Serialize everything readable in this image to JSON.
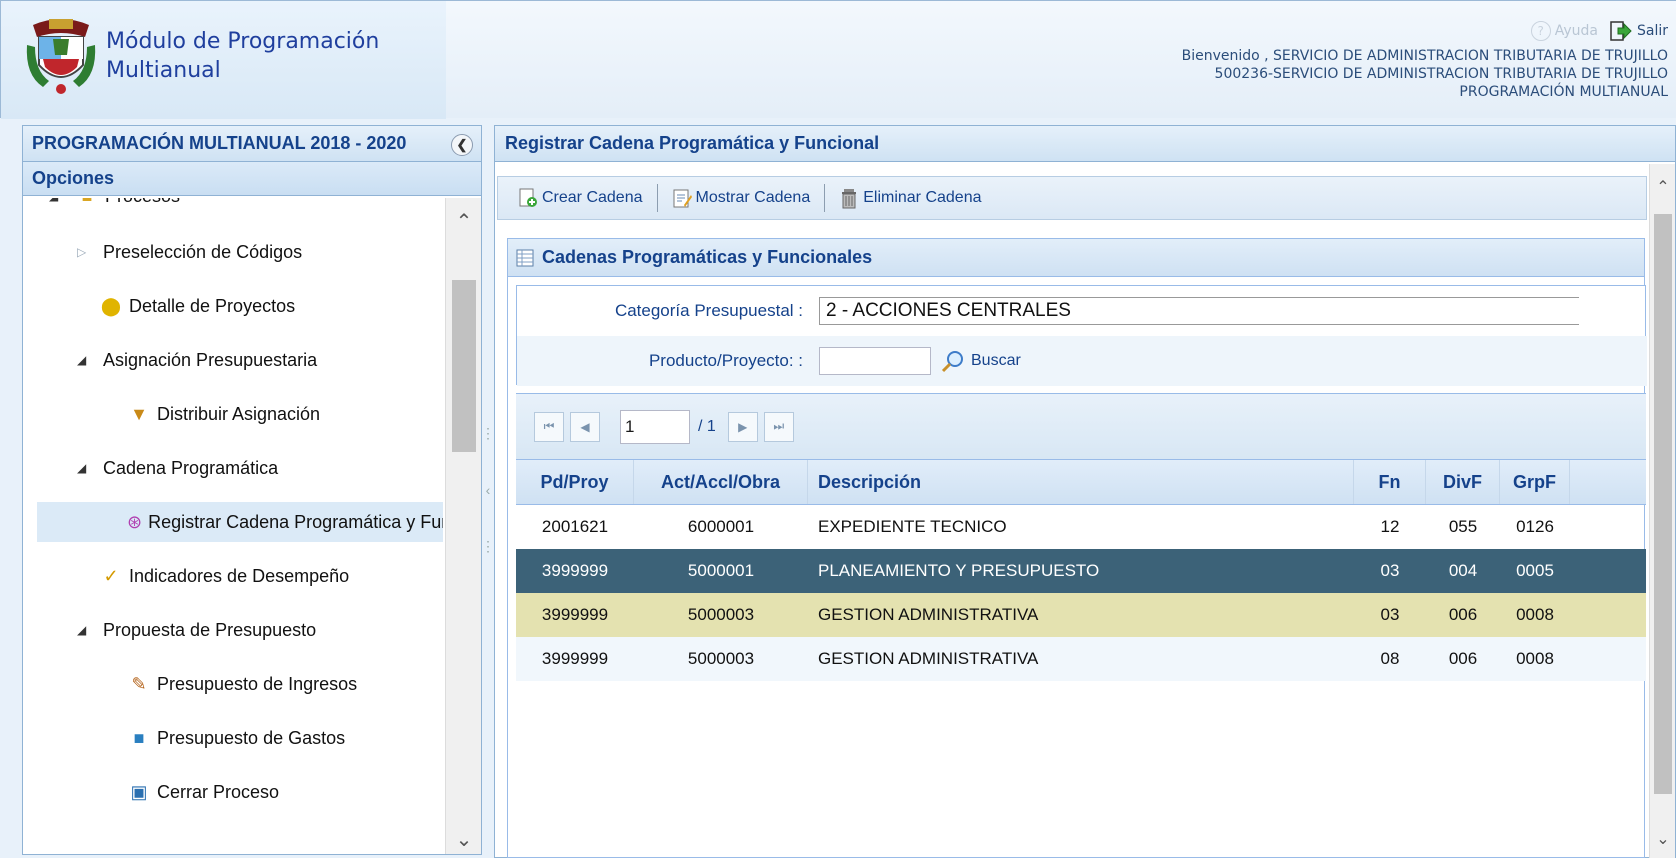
{
  "header": {
    "app_title_line1": "Módulo de Programación",
    "app_title_line2": "Multianual",
    "help_label": "Ayuda",
    "exit_label": "Salir",
    "welcome": "Bienvenido , SERVICIO DE ADMINISTRACION TRIBUTARIA DE TRUJILLO",
    "entity": "500236-SERVICIO DE ADMINISTRACION TRIBUTARIA DE TRUJILLO",
    "module": "PROGRAMACIÓN MULTIANUAL"
  },
  "sidebar": {
    "title": "PROGRAMACIÓN MULTIANUAL 2018 - 2020",
    "options_label": "Opciones",
    "items": [
      {
        "label": "Procesos",
        "arrow": "◢",
        "icon": "folder-icon"
      },
      {
        "label": "Preselección de Códigos",
        "arrow": "▷"
      },
      {
        "label": "Detalle de Proyectos",
        "icon": "coin-icon"
      },
      {
        "label": "Asignación Presupuestaria",
        "arrow": "◢"
      },
      {
        "label": "Distribuir Asignación",
        "icon": "money-bag-icon"
      },
      {
        "label": "Cadena Programática",
        "arrow": "◢"
      },
      {
        "label": "Registrar Cadena Programática y Funcional",
        "icon": "hierarchy-icon"
      },
      {
        "label": "Indicadores de Desempeño",
        "icon": "checklist-icon"
      },
      {
        "label": "Propuesta de Presupuesto",
        "arrow": "◢"
      },
      {
        "label": "Presupuesto de Ingresos",
        "icon": "book-icon"
      },
      {
        "label": "Presupuesto de Gastos",
        "icon": "books-icon"
      },
      {
        "label": "Cerrar Proceso",
        "icon": "computer-icon"
      }
    ]
  },
  "main": {
    "title": "Registrar Cadena Programática y Funcional",
    "toolbar": {
      "create": "Crear Cadena",
      "show": "Mostrar Cadena",
      "delete": "Eliminar Cadena"
    },
    "section_title": "Cadenas Programáticas y Funcionales",
    "form": {
      "category_label": "Categoría Presupuestal :",
      "category_value": "2 - ACCIONES CENTRALES",
      "product_label": "Producto/Proyecto: :",
      "product_value": "",
      "search_label": "Buscar"
    },
    "pager": {
      "page": "1",
      "total": "/ 1"
    },
    "columns": [
      "Pd/Proy",
      "Act/Accl/Obra",
      "Descripción",
      "Fn",
      "DivF",
      "GrpF"
    ],
    "rows": [
      {
        "pd": "2001621",
        "act": "6000001",
        "desc": "EXPEDIENTE TECNICO",
        "fn": "12",
        "divf": "055",
        "grpf": "0126"
      },
      {
        "pd": "3999999",
        "act": "5000001",
        "desc": "PLANEAMIENTO Y PRESUPUESTO",
        "fn": "03",
        "divf": "004",
        "grpf": "0005"
      },
      {
        "pd": "3999999",
        "act": "5000003",
        "desc": "GESTION ADMINISTRATIVA",
        "fn": "03",
        "divf": "006",
        "grpf": "0008"
      },
      {
        "pd": "3999999",
        "act": "5000003",
        "desc": "GESTION ADMINISTRATIVA",
        "fn": "08",
        "divf": "006",
        "grpf": "0008"
      }
    ]
  },
  "colors": {
    "accent": "#15428b",
    "selected_row": "#3c6278",
    "hover_row": "#e4e2b0"
  }
}
